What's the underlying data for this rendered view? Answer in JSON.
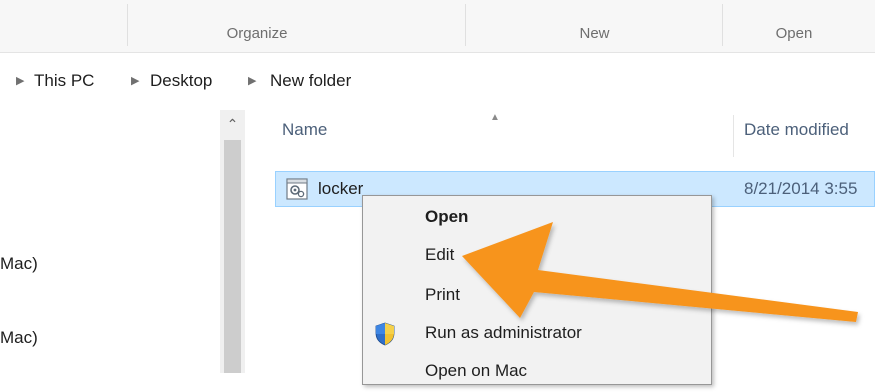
{
  "ribbon": {
    "groups": [
      "",
      "Organize",
      "New",
      "Open"
    ]
  },
  "address": {
    "crumbs": [
      "This PC",
      "Desktop",
      "New folder"
    ]
  },
  "navpane": {
    "items": [
      "Mac)",
      "Mac)"
    ]
  },
  "filelist": {
    "columns": {
      "name": "Name",
      "date": "Date modified"
    },
    "rows": [
      {
        "name": "locker",
        "date": "8/21/2014 3:55",
        "icon": "settings-file-icon"
      }
    ]
  },
  "context_menu": {
    "items": [
      {
        "label": "Open",
        "bold": true
      },
      {
        "label": "Edit"
      },
      {
        "label": "Print"
      },
      {
        "label": "Run as administrator",
        "icon": "uac-shield-icon"
      },
      {
        "label": "Open on Mac"
      }
    ]
  },
  "annotation": {
    "arrow_color": "#f7941d",
    "arrow_target": "Edit"
  },
  "colors": {
    "selection_fill": "#cce8ff",
    "selection_border": "#99d1ff",
    "header_text": "#4c607a"
  }
}
